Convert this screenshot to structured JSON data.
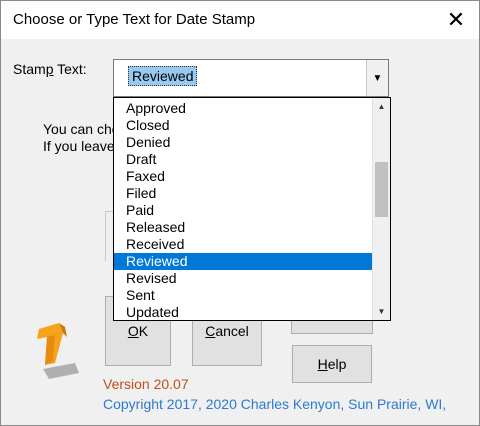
{
  "window": {
    "title": "Choose or Type Text for Date Stamp",
    "close_label": "✕"
  },
  "stamp": {
    "label_prefix": "Stam",
    "label_access": "p",
    "label_suffix": " Text:",
    "value": "Reviewed",
    "dropdown_arrow": "▼"
  },
  "description": {
    "line1": "You can cho",
    "line2": "If you leave"
  },
  "list": {
    "items": [
      "Approved",
      "Closed",
      "Denied",
      "Draft",
      "Faxed",
      "Filed",
      "Paid",
      "Released",
      "Received",
      "Reviewed",
      "Revised",
      "Sent",
      "Updated"
    ],
    "selected_index": 9,
    "scroll_up": "▲",
    "scroll_down": "▼",
    "scroll_fraction": 0.35
  },
  "buttons": {
    "ok_access": "O",
    "ok_rest": "K",
    "cancel_access": "C",
    "cancel_rest": "ancel",
    "help_access": "H",
    "help_rest": "elp"
  },
  "footer": {
    "version": "Version 20.07",
    "copyright": "Copyright 2017, 2020 Charles Kenyon, Sun Prairie, WI,"
  },
  "colors": {
    "selection": "#0078d7",
    "version_text": "#c05020",
    "copyright_text": "#2b7bd0",
    "logo_orange": "#f7a21b"
  }
}
